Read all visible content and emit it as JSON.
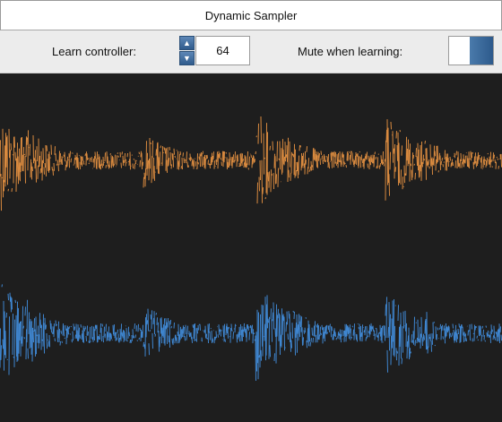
{
  "window": {
    "title": "Dynamic Sampler"
  },
  "controls": {
    "learn_label": "Learn controller:",
    "learn_value": "64",
    "mute_label": "Mute when learning:",
    "mute_on": true
  },
  "colors": {
    "waveform_top": "#d98a3f",
    "waveform_bottom": "#3f86d0",
    "background": "#1e1e1e",
    "accent": "#2f5b8c"
  },
  "waveforms": [
    {
      "channel": "top",
      "color": "#d98a3f"
    },
    {
      "channel": "bottom",
      "color": "#3f86d0"
    }
  ]
}
